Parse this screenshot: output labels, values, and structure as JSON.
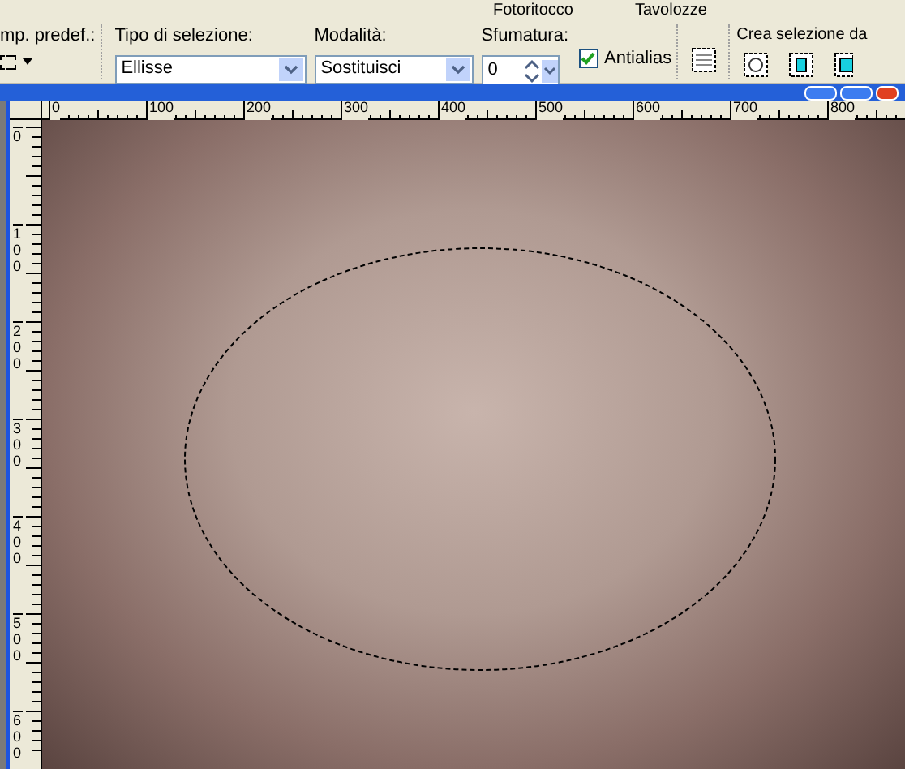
{
  "menu": [
    {
      "label": "Fotoritocco"
    },
    {
      "label": "Tavolozze"
    }
  ],
  "options": {
    "preset_label": "mp. predef.:",
    "selection_type": {
      "label": "Tipo di selezione:",
      "value": "Ellisse"
    },
    "mode": {
      "label": "Modalità:",
      "value": "Sostituisci"
    },
    "feather": {
      "label": "Sfumatura:",
      "value": "0"
    },
    "antialias": {
      "label": "Antialias",
      "checked": true
    },
    "create_label": "Crea selezione da"
  },
  "ruler": {
    "horizontal": [
      "0",
      "100",
      "200",
      "300",
      "400",
      "500",
      "600",
      "700",
      "800"
    ],
    "vertical": [
      "0",
      "100",
      "200",
      "300",
      "400",
      "500",
      "600"
    ]
  }
}
